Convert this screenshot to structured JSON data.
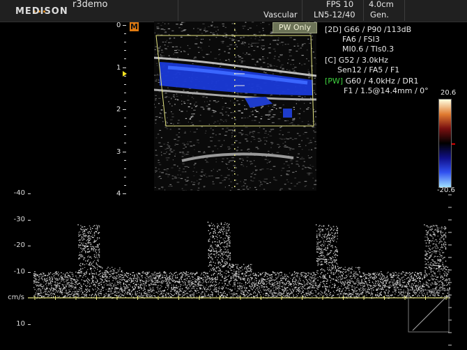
{
  "header": {
    "brand": "MEDISON",
    "study_title": "r3demo",
    "preset": "Vascular",
    "fps": "FPS 10",
    "probe": "LN5-12/40",
    "depth": "4.0cm",
    "mode": "Gen."
  },
  "controls": {
    "pw_only_label": "PW Only",
    "m_marker": "M"
  },
  "params": {
    "line1": "[2D] G66 / P90 /113dB",
    "line2": "FA6 / FSI3",
    "line3": "MI0.6 / TIs0.3",
    "line4": "[C] G52 / 3.0kHz",
    "line5": "Sen12 / FA5 / F1",
    "line6_tag": "[PW]",
    "line6_rest": " G60 / 4.0kHz  / DR1",
    "line7": "F1  / 1.5@14.4mm / 0°"
  },
  "color_bar": {
    "top_value": "20.6",
    "bottom_value": "-20.6",
    "colors": [
      "#ffffe0",
      "#e07a30",
      "#7a1010",
      "#000000",
      "#10108a",
      "#3050f0",
      "#a0e0ff"
    ]
  },
  "depth_scale": [
    "0",
    "1",
    "2",
    "3",
    "4"
  ],
  "spectral_axis": {
    "unit_label": "cm/s",
    "ticks": [
      "-40",
      "-30",
      "-20",
      "-10",
      "10"
    ]
  },
  "chart_data": {
    "type": "line",
    "x": [
      0,
      0.2,
      0.4,
      0.6,
      0.8,
      1.0,
      1.2,
      1.4,
      1.6,
      1.8,
      2.0,
      2.2,
      2.4,
      2.6,
      2.8,
      3.0,
      3.2,
      3.4,
      3.6,
      3.8
    ],
    "series": [
      {
        "values": [
          -10,
          -10,
          -28,
          -12,
          -10,
          -10,
          -10,
          -10,
          -29,
          -13,
          -10,
          -10,
          -10,
          -28,
          -12,
          -10,
          -10,
          -10,
          -28,
          -12
        ]
      }
    ],
    "ylabel": "cm/s",
    "ylim": [
      10,
      -40
    ],
    "yticks": [
      -40,
      -30,
      -20,
      -10,
      10
    ],
    "grid": false
  }
}
